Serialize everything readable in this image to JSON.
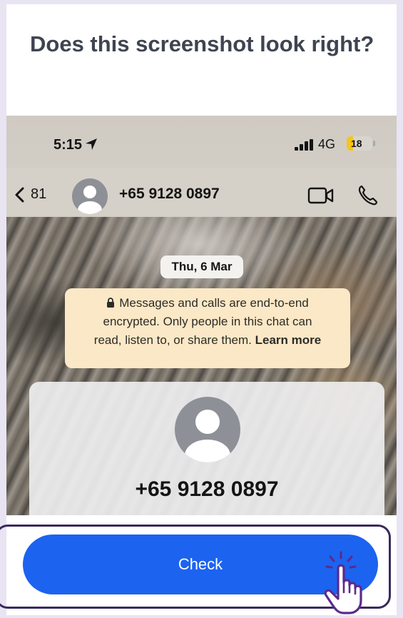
{
  "prompt": {
    "title": "Does this screenshot look right?"
  },
  "preview": {
    "status_bar": {
      "time": "5:15",
      "network": "4G",
      "battery": "18"
    },
    "header": {
      "back_count": "81",
      "contact": "+65 9128 0897"
    },
    "date_label": "Thu, 6 Mar",
    "encryption": {
      "line1": "Messages and calls are end-to-end",
      "line2": "encrypted. Only people in this chat can",
      "line3": "read, listen to, or share them.",
      "link": "Learn more"
    },
    "contact_card": {
      "number": "+65 9128 0897"
    }
  },
  "actions": {
    "check_label": "Check"
  },
  "colors": {
    "accent": "#1c63f0",
    "outline": "#3a2a5c",
    "title": "#3f4451",
    "notice_bg": "#fbe8c6"
  },
  "icons": [
    "location-arrow-icon",
    "signal-icon",
    "battery-icon",
    "back-chevron-icon",
    "avatar-icon",
    "video-call-icon",
    "phone-icon",
    "lock-icon",
    "pointer-hand-icon"
  ]
}
